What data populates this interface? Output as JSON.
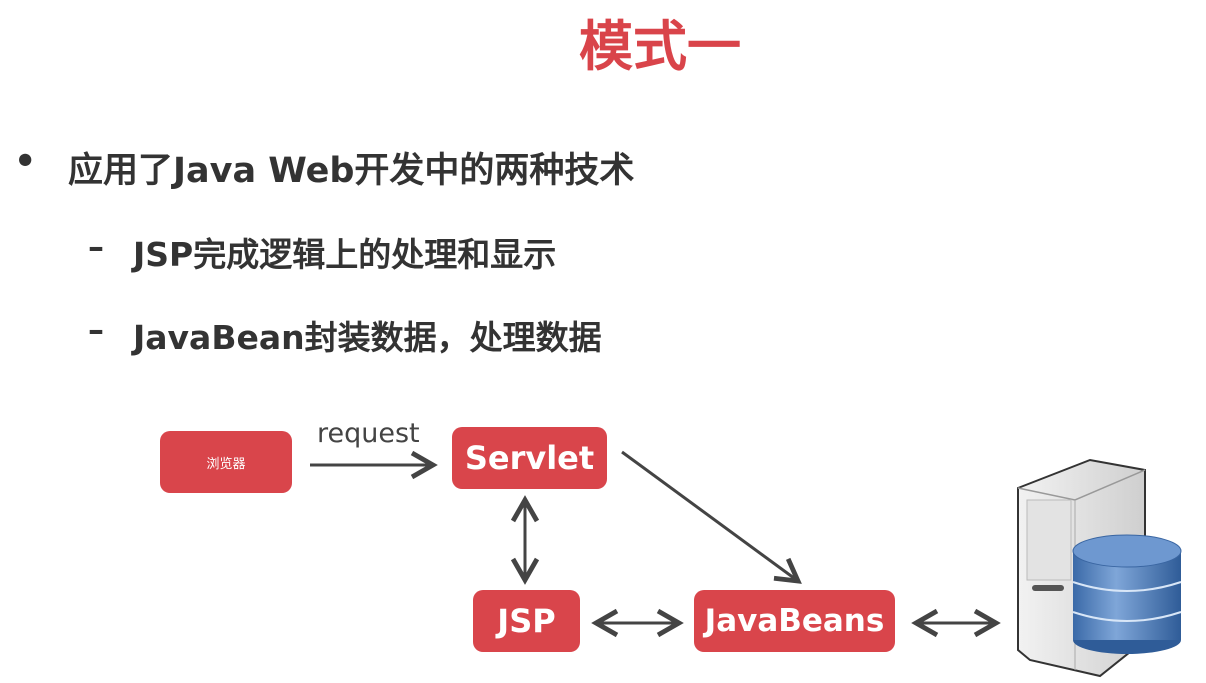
{
  "title": "模式一",
  "bullet": {
    "marker": "•",
    "text": "应用了Java Web开发中的两种技术"
  },
  "sub_items": [
    {
      "marker": "–",
      "text": "JSP完成逻辑上的处理和显示"
    },
    {
      "marker": "–",
      "text": "JavaBean封装数据，处理数据"
    }
  ],
  "diagram": {
    "browser": "浏览器",
    "request_label": "request",
    "servlet": "Servlet",
    "jsp": "JSP",
    "javabeans": "JavaBeans",
    "accent": "#d9454b"
  }
}
